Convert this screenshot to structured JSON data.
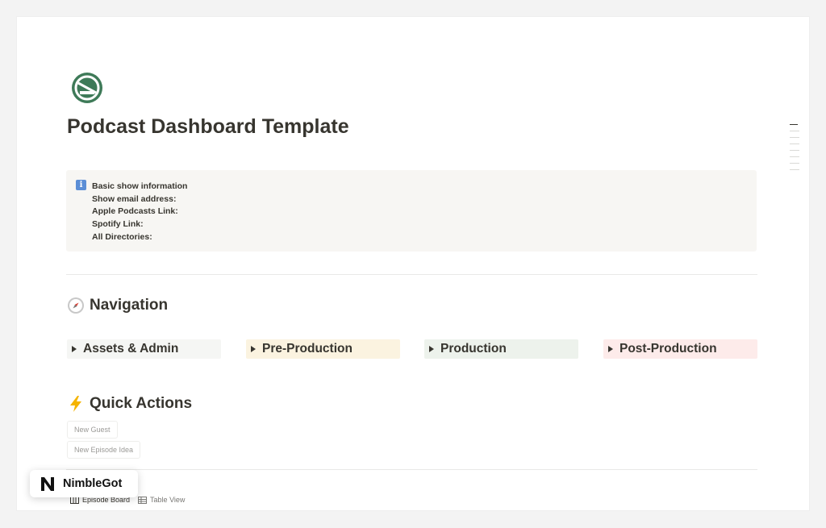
{
  "page": {
    "title": "Podcast Dashboard Template",
    "icon": "no-smoking-sign-icon",
    "icon_color": "#3e7a58"
  },
  "callout": {
    "icon": "info-icon",
    "lines": [
      "Basic show information",
      "Show email address:",
      "Apple Podcasts Link:",
      "Spotify Link:",
      "All Directories:"
    ]
  },
  "navigation": {
    "heading": "Navigation",
    "icon": "compass-icon",
    "items": [
      {
        "label": "Assets & Admin",
        "bg": "#f5f6f4"
      },
      {
        "label": "Pre-Production",
        "bg": "#fbf3e0"
      },
      {
        "label": "Production",
        "bg": "#edf2ec"
      },
      {
        "label": "Post-Production",
        "bg": "#fdebea"
      }
    ]
  },
  "quick_actions": {
    "heading": "Quick Actions",
    "icon": "lightning-icon",
    "buttons": [
      "New Guest",
      "New Episode Idea"
    ]
  },
  "views": {
    "tabs": [
      {
        "label": "Episode Board",
        "icon": "board-icon"
      },
      {
        "label": "Table View",
        "icon": "table-icon"
      }
    ]
  },
  "badge": {
    "brand": "NimbleGot",
    "logo_letter": "N"
  }
}
